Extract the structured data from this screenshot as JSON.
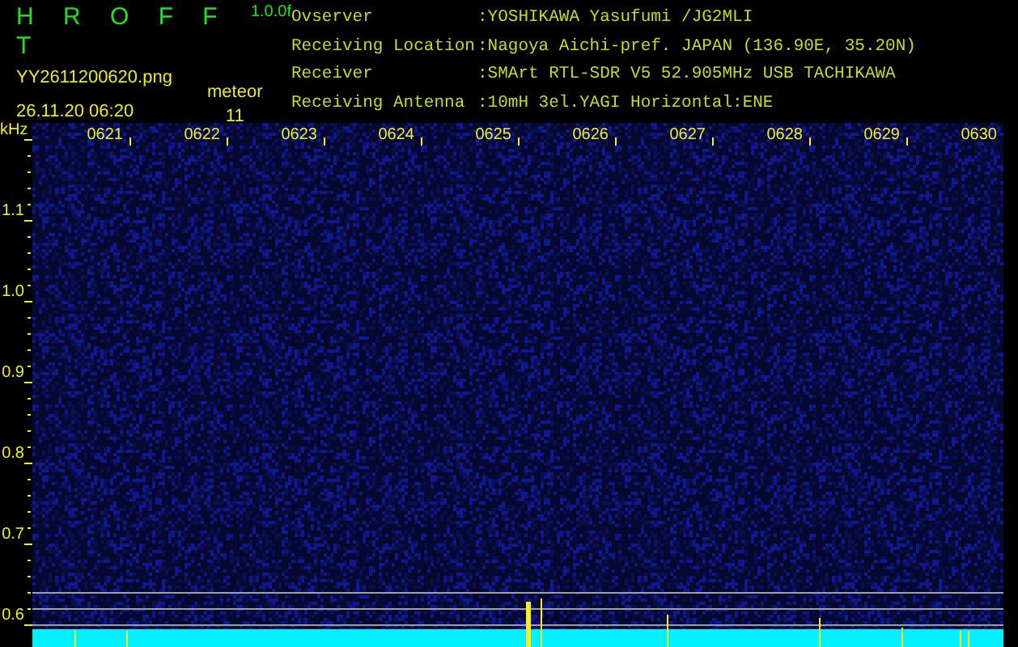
{
  "app": {
    "title": "H R O F F T",
    "version": "1.0.0f",
    "file": "YY2611200620.png",
    "datetime": "26.11.20 06:20",
    "mode": "meteor",
    "count": "11"
  },
  "info": [
    {
      "label": "Ovserver",
      "value": ":YOSHIKAWA Yasufumi /JG2MLI"
    },
    {
      "label": "Receiving Location",
      "value": ":Nagoya Aichi-pref. JAPAN (136.90E, 35.20N)"
    },
    {
      "label": "Receiver",
      "value": ":SMArt RTL-SDR V5 52.905MHz USB TACHIKAWA"
    },
    {
      "label": "Receiving Antenna",
      "value": ":10mH 3el.YAGI Horizontal:ENE"
    }
  ],
  "spectrogram": {
    "unit": "kHz",
    "y_labels": [
      "1.1",
      "1.0",
      "0.9",
      "0.8",
      "0.7",
      "0.6"
    ],
    "time_labels": [
      "0621",
      "0622",
      "0623",
      "0624",
      "0625",
      "0626",
      "0627",
      "0628",
      "0629",
      "0630"
    ]
  }
}
